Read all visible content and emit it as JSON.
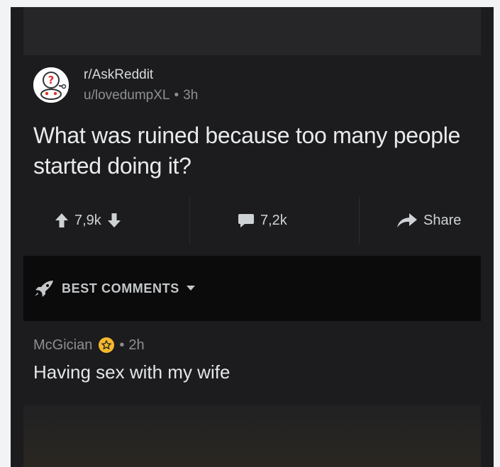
{
  "post": {
    "subreddit": "r/AskReddit",
    "author": "u/lovedumpXL",
    "separator": "•",
    "age": "3h",
    "title": "What was ruined because too many people started doing it?"
  },
  "actions": {
    "upvotes": "7,9k",
    "comments": "7,2k",
    "share_label": "Share"
  },
  "sort": {
    "label": "BEST COMMENTS"
  },
  "comment": {
    "author": "McGician",
    "separator": "•",
    "age": "2h",
    "body": "Having sex with my wife"
  },
  "icons": {
    "avatar": "reddit-alien-question-icon",
    "upvote": "arrow-up-icon",
    "downvote": "arrow-down-icon",
    "comments": "comment-bubble-icon",
    "share": "share-arrow-icon",
    "sort": "rocket-icon",
    "dropdown": "caret-down-icon",
    "award": "star-badge-icon"
  },
  "colors": {
    "background": "#1c1c1e",
    "text": "#e8eaec",
    "muted": "#8c8f91",
    "award_gold": "#f5b82e"
  }
}
